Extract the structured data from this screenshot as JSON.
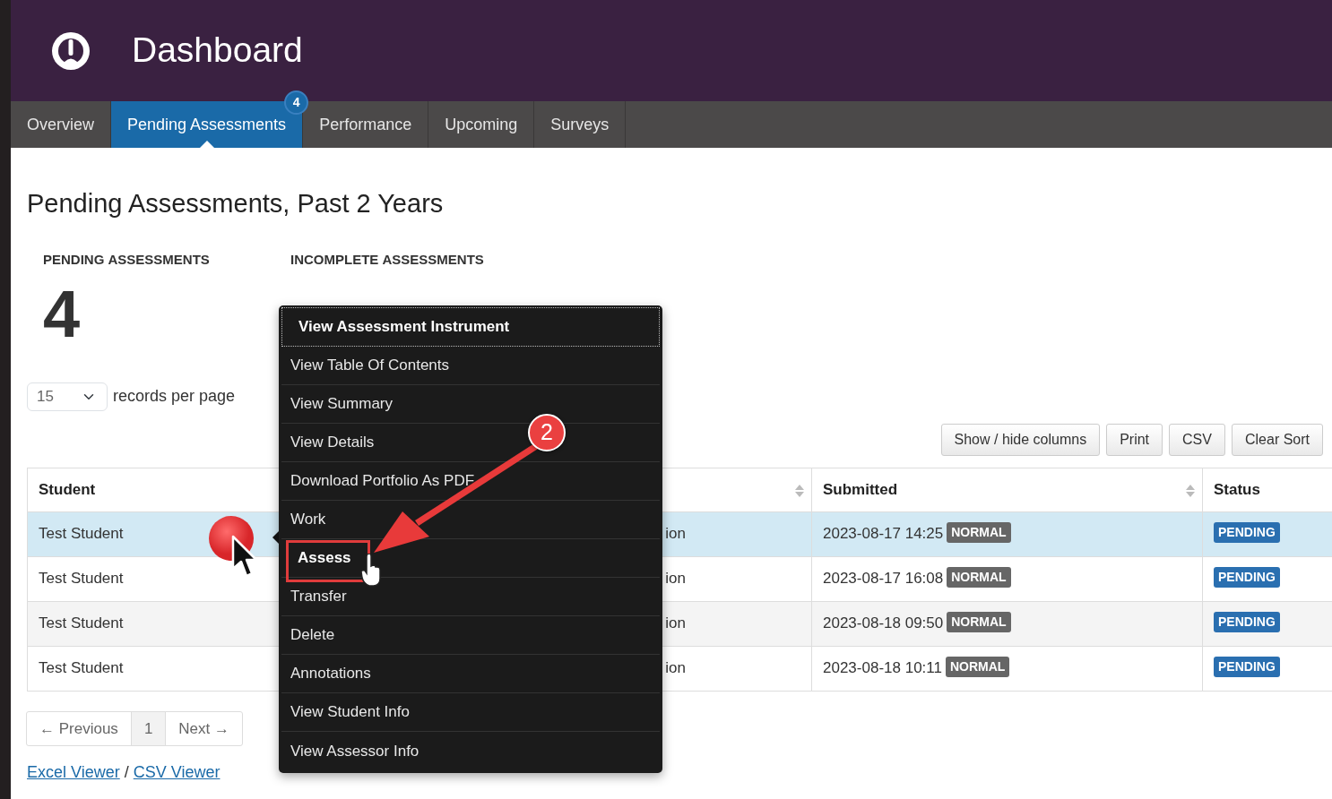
{
  "header": {
    "title": "Dashboard"
  },
  "tabs": [
    {
      "label": "Overview",
      "selected": false
    },
    {
      "label": "Pending Assessments",
      "selected": true,
      "badge": "4"
    },
    {
      "label": "Performance",
      "selected": false
    },
    {
      "label": "Upcoming",
      "selected": false
    },
    {
      "label": "Surveys",
      "selected": false
    }
  ],
  "page_title": "Pending Assessments, Past 2 Years",
  "stats": [
    {
      "label": "PENDING **ASSESSMENTS**",
      "value": "4"
    },
    {
      "label": "INCOMPLETE **ASSESSMENTS**"
    }
  ],
  "page_size": {
    "value": "15",
    "label": "records per page"
  },
  "toolbar_buttons": [
    "Show / hide columns",
    "Print",
    "CSV",
    "Clear Sort"
  ],
  "table": {
    "columns": [
      {
        "label": "Student",
        "sortable": false
      },
      {
        "sortable": true
      },
      {
        "label": "Submitted",
        "sortable": true
      },
      {
        "label": "Status",
        "sortable": false
      }
    ],
    "rows": [
      {
        "student": "Test Student",
        "instrument": "ion",
        "submitted": "2023-08-17 14:25",
        "priority": "NORMAL",
        "status": "PENDING",
        "selected": true
      },
      {
        "student": "Test Student",
        "instrument": "ion",
        "submitted": "2023-08-17 16:08",
        "priority": "NORMAL",
        "status": "PENDING",
        "selected": false
      },
      {
        "student": "Test Student",
        "instrument": "ion",
        "submitted": "2023-08-18 09:50",
        "priority": "NORMAL",
        "status": "PENDING",
        "selected": false
      },
      {
        "student": "Test Student",
        "instrument": "ion",
        "submitted": "2023-08-18 10:11",
        "priority": "NORMAL",
        "status": "PENDING",
        "selected": false
      }
    ]
  },
  "pagination": {
    "previous": "← Previous",
    "pages": [
      {
        "label": "1",
        "selected": true
      }
    ],
    "next": "Next →"
  },
  "footer_links": [
    {
      "label": "Excel Viewer"
    },
    {
      "label": "CSV Viewer"
    }
  ],
  "footer_separator": "/",
  "context_menu": {
    "items": [
      {
        "label": "View Assessment Instrument",
        "focused": true,
        "highlighted": false
      },
      {
        "label": "View Table Of Contents",
        "focused": false,
        "highlighted": false
      },
      {
        "label": "View Summary",
        "focused": false,
        "highlighted": false
      },
      {
        "label": "View Details",
        "focused": false,
        "highlighted": false
      },
      {
        "label": "Download Portfolio As PDF",
        "focused": false,
        "highlighted": false
      },
      {
        "label": "Work",
        "focused": false,
        "highlighted": false
      },
      {
        "label": "Assess",
        "focused": false,
        "highlighted": true
      },
      {
        "label": "Transfer",
        "focused": false,
        "highlighted": false
      },
      {
        "label": "Delete",
        "focused": false,
        "highlighted": false
      },
      {
        "label": "Annotations",
        "focused": false,
        "highlighted": false
      },
      {
        "label": "View Student Info",
        "focused": false,
        "highlighted": false
      },
      {
        "label": "View Assessor Info",
        "focused": false,
        "highlighted": false
      }
    ]
  },
  "annotation": {
    "step": "2"
  }
}
